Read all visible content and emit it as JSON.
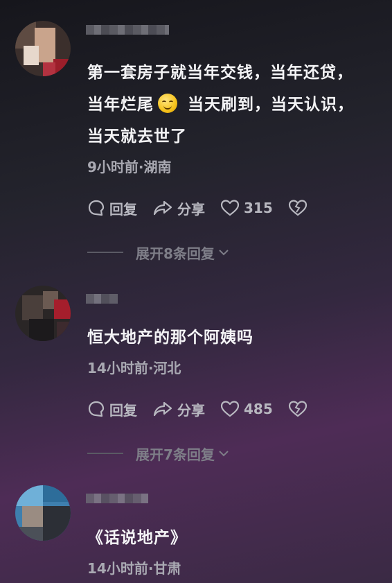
{
  "comments": [
    {
      "text_line1": "第一套房子就当年交钱，当年还贷，",
      "text_line2a": "当年烂尾",
      "text_line2b": "当天刷到，当天认识，",
      "text_line3": "当天就去世了",
      "meta": "9小时前·湖南",
      "reply_label": "回复",
      "share_label": "分享",
      "like_count": "315",
      "expand_label": "展开8条回复"
    },
    {
      "text": "恒大地产的那个阿姨吗",
      "meta": "14小时前·河北",
      "reply_label": "回复",
      "share_label": "分享",
      "like_count": "485",
      "expand_label": "展开7条回复"
    },
    {
      "text": "《话说地产》",
      "meta": "14小时前·甘肃"
    }
  ],
  "icons": {
    "reply": "comment-bubble-icon",
    "share": "share-arrow-icon",
    "like": "heart-icon",
    "dislike": "broken-heart-icon",
    "expand": "chevron-down-icon",
    "emoji": "smiling-face-emoji"
  }
}
